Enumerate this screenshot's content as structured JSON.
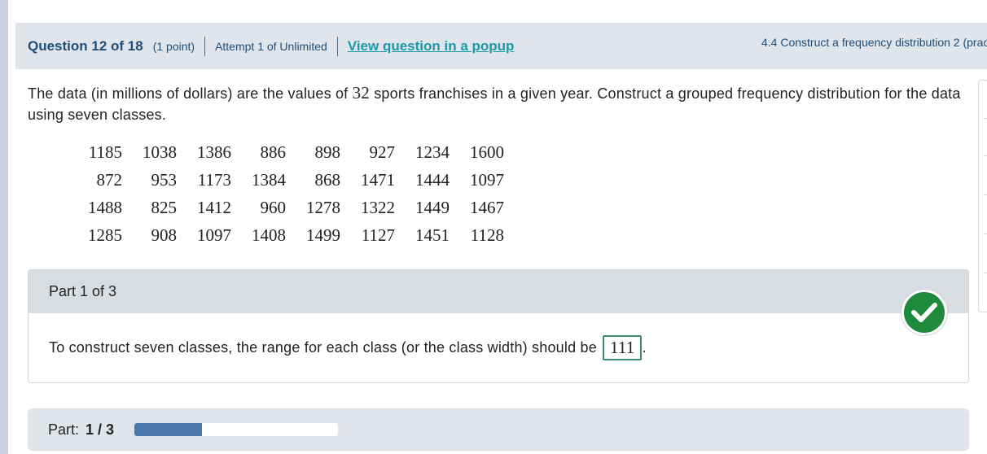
{
  "header": {
    "question_title": "Question 12 of 18",
    "points": "(1 point)",
    "attempt": "Attempt 1 of Unlimited",
    "popup_link": "View question in a popup",
    "topic": "4.4 Construct a frequency distribution 2 (prac"
  },
  "problem": {
    "text_before": "The data (in millions of dollars) are the values of ",
    "count": "32",
    "text_after": " sports franchises in a given year. Construct a grouped frequency distribution for the data using seven classes."
  },
  "data_rows": [
    [
      "1185",
      "1038",
      "1386",
      "886",
      "898",
      "927",
      "1234",
      "1600"
    ],
    [
      "872",
      "953",
      "1173",
      "1384",
      "868",
      "1471",
      "1444",
      "1097"
    ],
    [
      "1488",
      "825",
      "1412",
      "960",
      "1278",
      "1322",
      "1449",
      "1467"
    ],
    [
      "1285",
      "908",
      "1097",
      "1408",
      "1499",
      "1127",
      "1451",
      "1128"
    ]
  ],
  "part": {
    "label": "Part 1 of 3",
    "prompt": "To construct seven classes, the range for each class (or the class width) should be",
    "answer": "111",
    "suffix": ".",
    "status": "correct"
  },
  "progress": {
    "label": "Part:",
    "value": "1 / 3",
    "fraction": 0.333
  },
  "colors": {
    "accent": "#1a9aa8",
    "title": "#1f4e79",
    "correct": "#1e8a3c",
    "progress_fill": "#4a78ad"
  }
}
